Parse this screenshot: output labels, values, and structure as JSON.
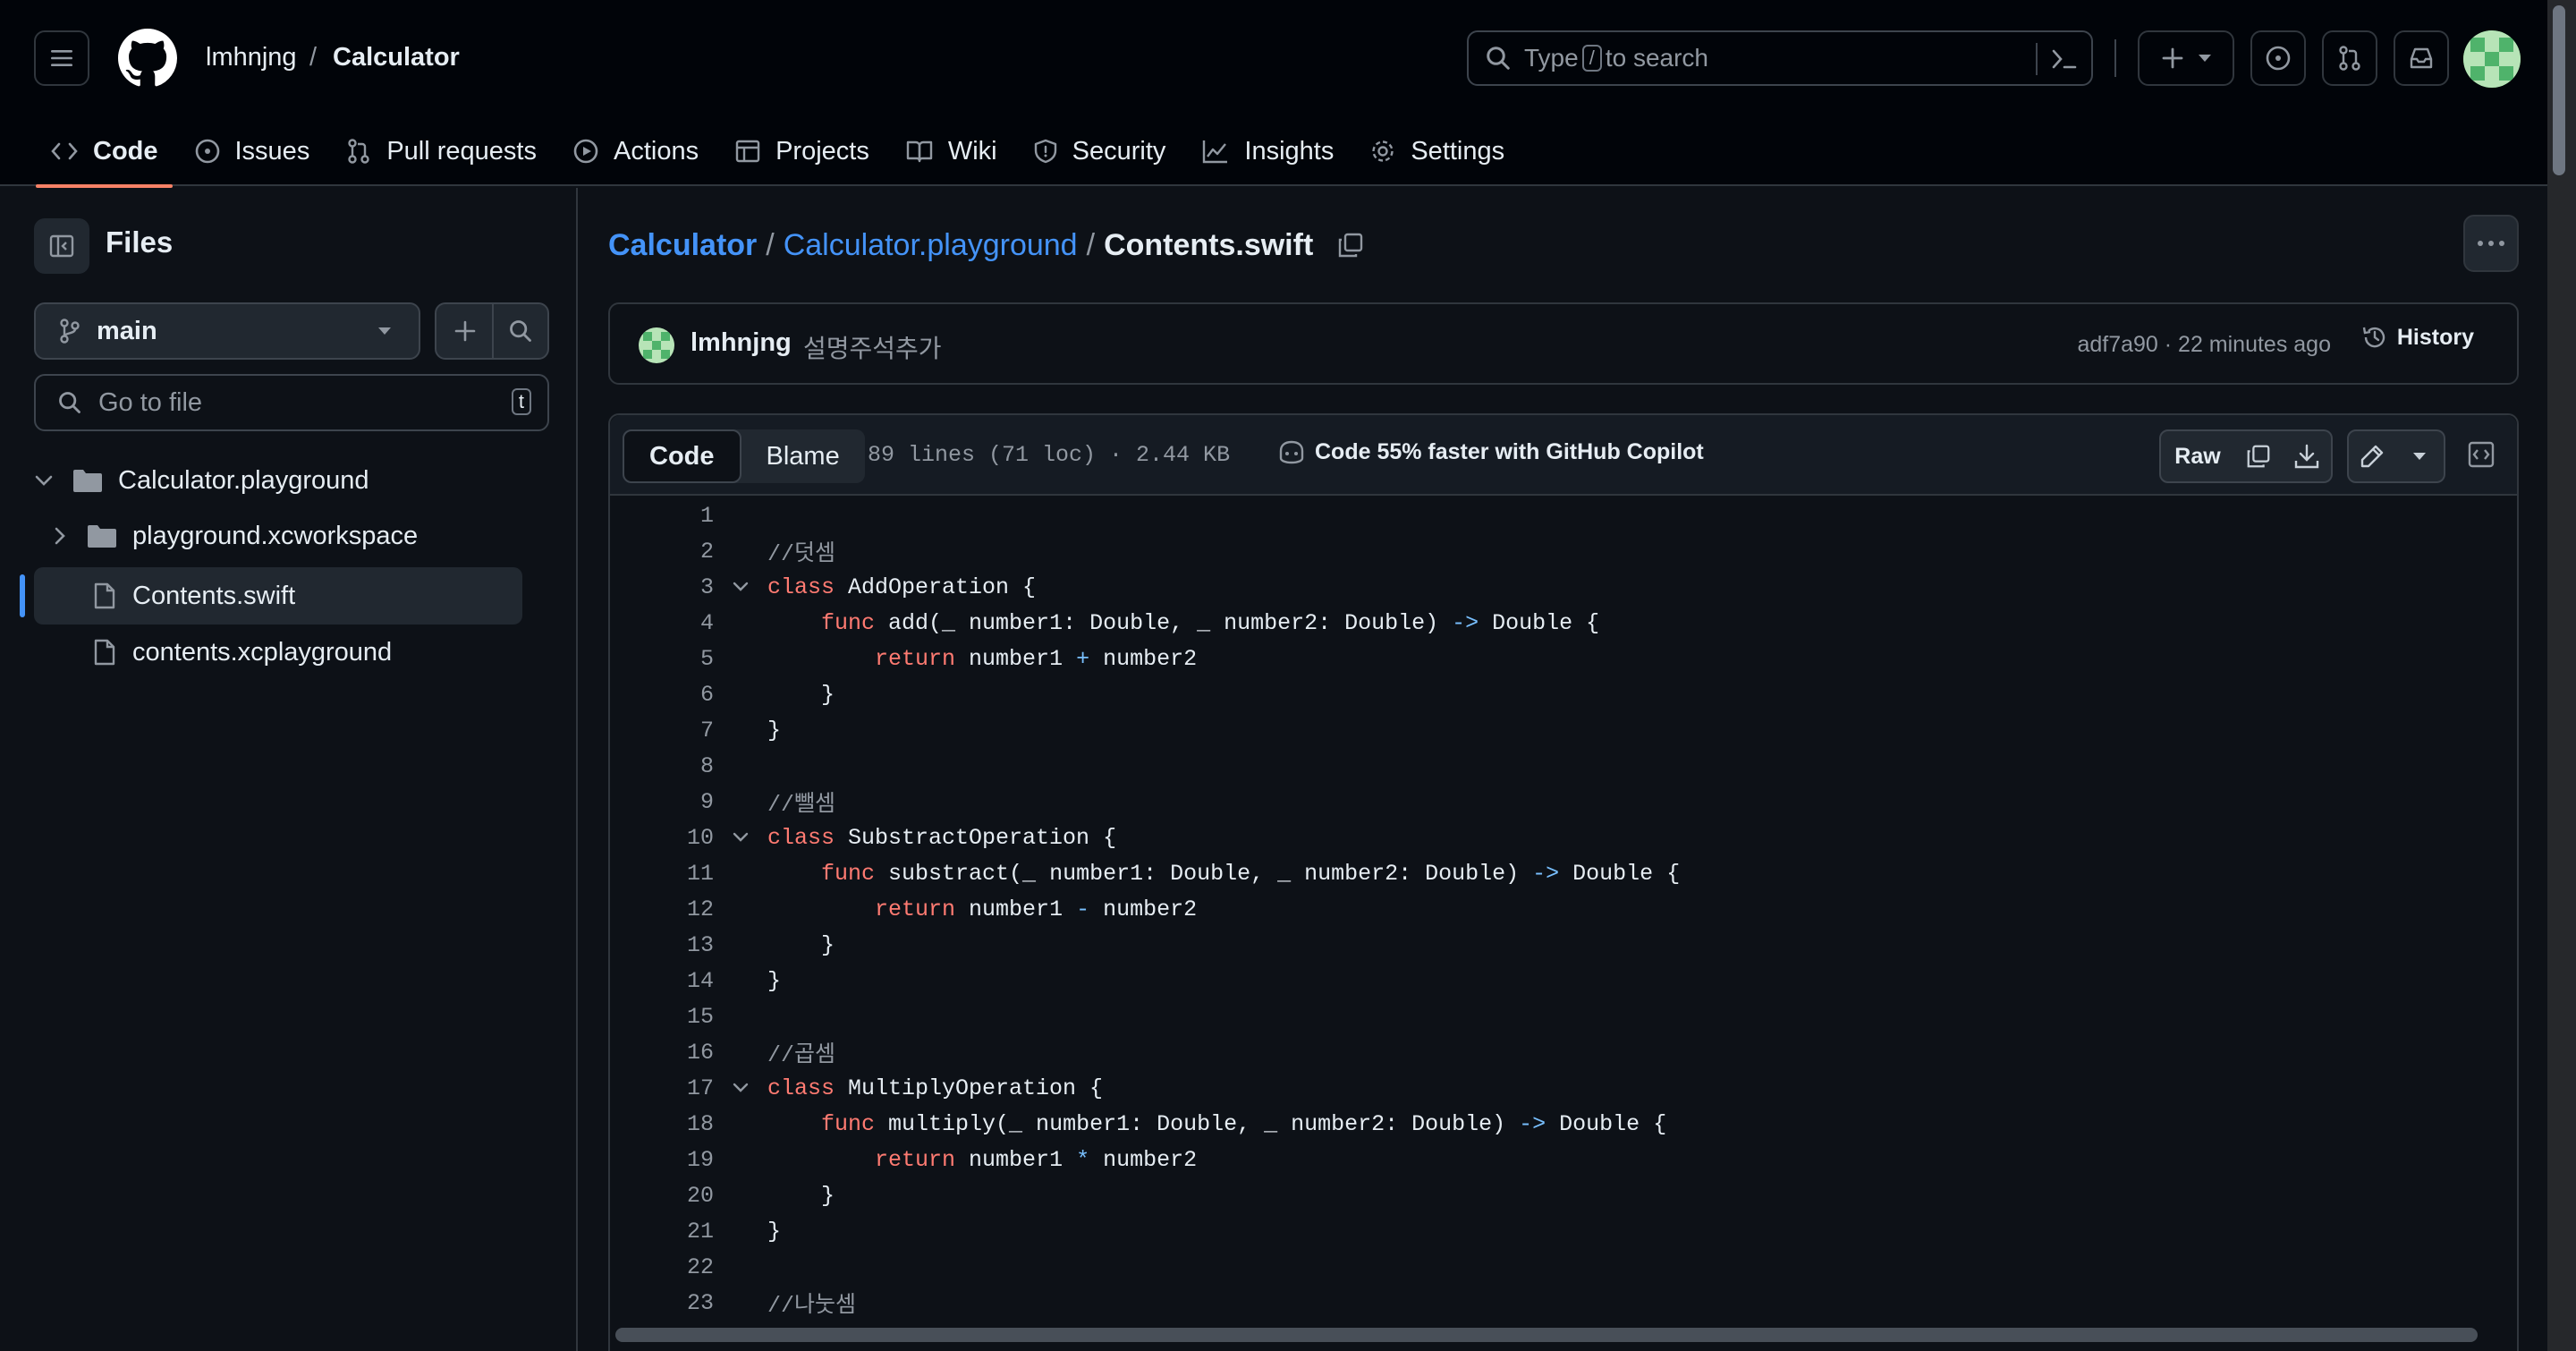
{
  "header": {
    "owner": "lmhnjng",
    "repo": "Calculator",
    "search_prefix": "Type",
    "search_key": "/",
    "search_suffix": "to search"
  },
  "tabs": [
    {
      "label": "Code",
      "icon": "code-icon"
    },
    {
      "label": "Issues",
      "icon": "issue-icon"
    },
    {
      "label": "Pull requests",
      "icon": "pull-request-icon"
    },
    {
      "label": "Actions",
      "icon": "play-icon"
    },
    {
      "label": "Projects",
      "icon": "table-icon"
    },
    {
      "label": "Wiki",
      "icon": "book-icon"
    },
    {
      "label": "Security",
      "icon": "shield-icon"
    },
    {
      "label": "Insights",
      "icon": "graph-icon"
    },
    {
      "label": "Settings",
      "icon": "gear-icon"
    }
  ],
  "sidebar": {
    "title": "Files",
    "branch": "main",
    "goto_placeholder": "Go to file",
    "goto_key": "t",
    "tree": [
      {
        "label": "Calculator.playground",
        "type": "folder-open"
      },
      {
        "label": "playground.xcworkspace",
        "type": "folder"
      },
      {
        "label": "Contents.swift",
        "type": "file",
        "selected": true
      },
      {
        "label": "contents.xcplayground",
        "type": "file"
      }
    ]
  },
  "breadcrumb": {
    "root": "Calculator",
    "folder": "Calculator.playground",
    "file": "Contents.swift"
  },
  "commit": {
    "author": "lmhnjng",
    "message": "설명주석추가",
    "sha_time": "adf7a90 · 22 minutes ago",
    "history": "History"
  },
  "file": {
    "tab_code": "Code",
    "tab_blame": "Blame",
    "meta": "89 lines (71 loc) · 2.44 KB",
    "copilot": "Code 55% faster with GitHub Copilot",
    "raw": "Raw"
  },
  "code": [
    {
      "n": "1",
      "fold": false,
      "parts": []
    },
    {
      "n": "2",
      "fold": false,
      "parts": [
        [
          "cm",
          "//덧셈"
        ]
      ]
    },
    {
      "n": "3",
      "fold": true,
      "parts": [
        [
          "kw",
          "class"
        ],
        [
          "txt",
          " AddOperation {"
        ]
      ]
    },
    {
      "n": "4",
      "fold": false,
      "parts": [
        [
          "txt",
          "    "
        ],
        [
          "kw",
          "func"
        ],
        [
          "txt",
          " add(_ number1: Double, _ number2: Double) "
        ],
        [
          "op",
          "->"
        ],
        [
          "txt",
          " Double {"
        ]
      ]
    },
    {
      "n": "5",
      "fold": false,
      "parts": [
        [
          "txt",
          "        "
        ],
        [
          "kw",
          "return"
        ],
        [
          "txt",
          " number1 "
        ],
        [
          "op",
          "+"
        ],
        [
          "txt",
          " number2"
        ]
      ]
    },
    {
      "n": "6",
      "fold": false,
      "parts": [
        [
          "txt",
          "    }"
        ]
      ]
    },
    {
      "n": "7",
      "fold": false,
      "parts": [
        [
          "txt",
          "}"
        ]
      ]
    },
    {
      "n": "8",
      "fold": false,
      "parts": []
    },
    {
      "n": "9",
      "fold": false,
      "parts": [
        [
          "cm",
          "//뺄셈"
        ]
      ]
    },
    {
      "n": "10",
      "fold": true,
      "parts": [
        [
          "kw",
          "class"
        ],
        [
          "txt",
          " SubstractOperation {"
        ]
      ]
    },
    {
      "n": "11",
      "fold": false,
      "parts": [
        [
          "txt",
          "    "
        ],
        [
          "kw",
          "func"
        ],
        [
          "txt",
          " substract(_ number1: Double, _ number2: Double) "
        ],
        [
          "op",
          "->"
        ],
        [
          "txt",
          " Double {"
        ]
      ]
    },
    {
      "n": "12",
      "fold": false,
      "parts": [
        [
          "txt",
          "        "
        ],
        [
          "kw",
          "return"
        ],
        [
          "txt",
          " number1 "
        ],
        [
          "op",
          "-"
        ],
        [
          "txt",
          " number2"
        ]
      ]
    },
    {
      "n": "13",
      "fold": false,
      "parts": [
        [
          "txt",
          "    }"
        ]
      ]
    },
    {
      "n": "14",
      "fold": false,
      "parts": [
        [
          "txt",
          "}"
        ]
      ]
    },
    {
      "n": "15",
      "fold": false,
      "parts": []
    },
    {
      "n": "16",
      "fold": false,
      "parts": [
        [
          "cm",
          "//곱셈"
        ]
      ]
    },
    {
      "n": "17",
      "fold": true,
      "parts": [
        [
          "kw",
          "class"
        ],
        [
          "txt",
          " MultiplyOperation {"
        ]
      ]
    },
    {
      "n": "18",
      "fold": false,
      "parts": [
        [
          "txt",
          "    "
        ],
        [
          "kw",
          "func"
        ],
        [
          "txt",
          " multiply(_ number1: Double, _ number2: Double) "
        ],
        [
          "op",
          "->"
        ],
        [
          "txt",
          " Double {"
        ]
      ]
    },
    {
      "n": "19",
      "fold": false,
      "parts": [
        [
          "txt",
          "        "
        ],
        [
          "kw",
          "return"
        ],
        [
          "txt",
          " number1 "
        ],
        [
          "op",
          "*"
        ],
        [
          "txt",
          " number2"
        ]
      ]
    },
    {
      "n": "20",
      "fold": false,
      "parts": [
        [
          "txt",
          "    }"
        ]
      ]
    },
    {
      "n": "21",
      "fold": false,
      "parts": [
        [
          "txt",
          "}"
        ]
      ]
    },
    {
      "n": "22",
      "fold": false,
      "parts": []
    },
    {
      "n": "23",
      "fold": false,
      "parts": [
        [
          "cm",
          "//나눗셈"
        ]
      ]
    }
  ],
  "colors": {
    "background": "#0d1117",
    "header": "#010409",
    "link": "#4493f8",
    "keyword": "#ff7b72",
    "active_tab": "#f78166"
  }
}
